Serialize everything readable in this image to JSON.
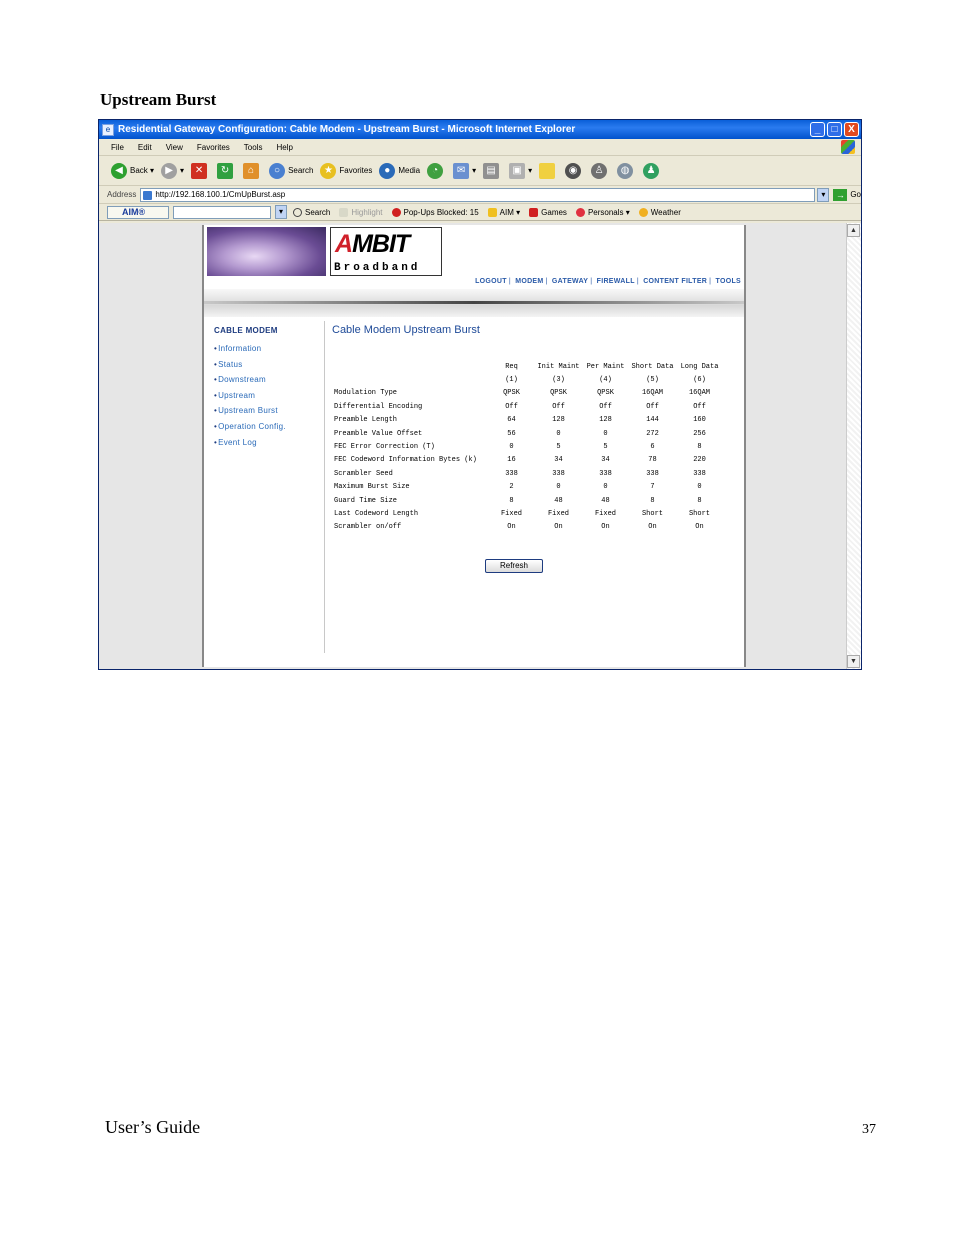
{
  "doc": {
    "heading": "Upstream Burst",
    "footer_left": "User’s Guide",
    "footer_page": "37"
  },
  "window": {
    "title": "Residential Gateway Configuration: Cable Modem - Upstream Burst - Microsoft Internet Explorer",
    "controls": [
      "_",
      "□",
      "X"
    ]
  },
  "menu": [
    "File",
    "Edit",
    "View",
    "Favorites",
    "Tools",
    "Help"
  ],
  "toolbar": {
    "back": "Back",
    "search": "Search",
    "favorites": "Favorites",
    "media": "Media"
  },
  "address": {
    "label": "Address",
    "url": "http://192.168.100.1/CmUpBurst.asp",
    "go": "Go"
  },
  "aimbar": {
    "aim_label": "AIM®",
    "search": "Search",
    "highlight": "Highlight",
    "popups": "Pop-Ups Blocked: 15",
    "aim": "AIM",
    "games": "Games",
    "personals": "Personals",
    "weather": "Weather"
  },
  "brand": {
    "ambit_a": "A",
    "ambit_rest": "MBIT",
    "broadband": "Broadband"
  },
  "topnav": [
    "LOGOUT",
    "MODEM",
    "GATEWAY",
    "FIREWALL",
    "CONTENT FILTER",
    "TOOLS"
  ],
  "sidebar": {
    "title": "CABLE MODEM",
    "items": [
      "Information",
      "Status",
      "Downstream",
      "Upstream",
      "Upstream Burst",
      "Operation Config.",
      "Event Log"
    ]
  },
  "main": {
    "title": "Cable Modem Upstream Burst",
    "refresh_label": "Refresh"
  },
  "table": {
    "columns": [
      "Req",
      "Init Maint",
      "Per Maint",
      "Short Data",
      "Long Data"
    ],
    "column_ids": [
      "(1)",
      "(3)",
      "(4)",
      "(5)",
      "(6)"
    ],
    "rows": [
      {
        "label": "Modulation Type",
        "values": [
          "QPSK",
          "QPSK",
          "QPSK",
          "16QAM",
          "16QAM"
        ]
      },
      {
        "label": "Differential Encoding",
        "values": [
          "Off",
          "Off",
          "Off",
          "Off",
          "Off"
        ]
      },
      {
        "label": "Preamble Length",
        "values": [
          "64",
          "128",
          "128",
          "144",
          "160"
        ]
      },
      {
        "label": "Preamble Value Offset",
        "values": [
          "56",
          "0",
          "0",
          "272",
          "256"
        ]
      },
      {
        "label": "FEC Error Correction (T)",
        "values": [
          "0",
          "5",
          "5",
          "6",
          "8"
        ]
      },
      {
        "label": "FEC Codeword Information Bytes (k)",
        "values": [
          "16",
          "34",
          "34",
          "78",
          "220"
        ]
      },
      {
        "label": "Scrambler Seed",
        "values": [
          "338",
          "338",
          "338",
          "338",
          "338"
        ]
      },
      {
        "label": "Maximum Burst Size",
        "values": [
          "2",
          "0",
          "0",
          "7",
          "0"
        ]
      },
      {
        "label": "Guard Time Size",
        "values": [
          "8",
          "48",
          "48",
          "8",
          "8"
        ]
      },
      {
        "label": "Last Codeword Length",
        "values": [
          "Fixed",
          "Fixed",
          "Fixed",
          "Short",
          "Short"
        ]
      },
      {
        "label": "Scrambler on/off",
        "values": [
          "On",
          "On",
          "On",
          "On",
          "On"
        ]
      }
    ]
  }
}
